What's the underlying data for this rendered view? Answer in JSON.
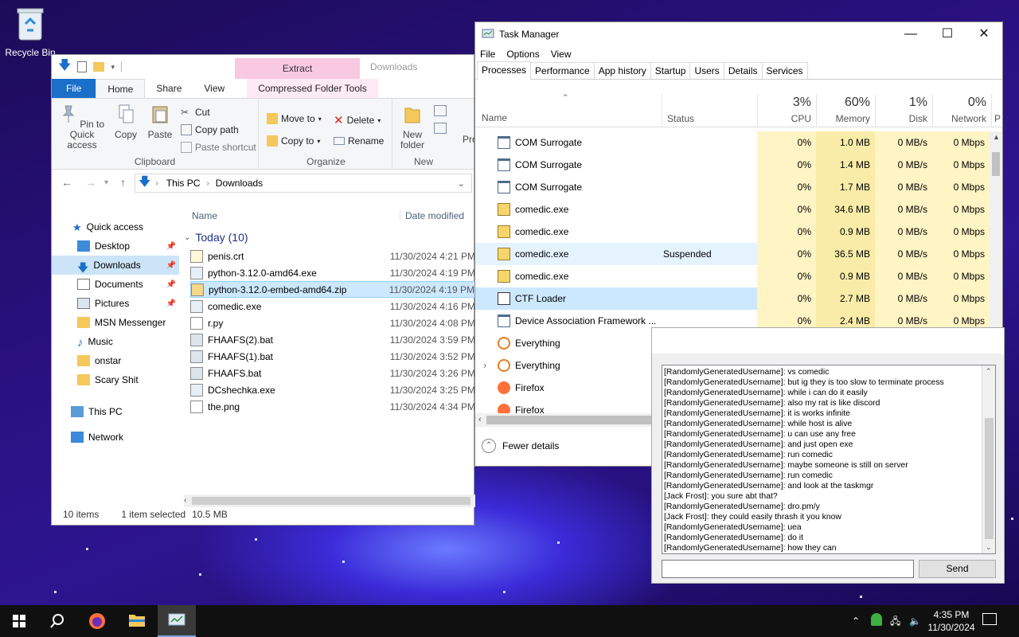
{
  "desktop": {
    "recycle_bin": "Recycle Bin"
  },
  "explorer": {
    "ribbon_tabs": {
      "file": "File",
      "home": "Home",
      "share": "Share",
      "view": "View",
      "extract": "Extract",
      "compressed": "Compressed Folder Tools",
      "downloads_title": "Downloads"
    },
    "clipboard": {
      "pin": "Pin to Quick access",
      "copy": "Copy",
      "paste": "Paste",
      "cut": "Cut",
      "copy_path": "Copy path",
      "paste_shortcut": "Paste shortcut",
      "group": "Clipboard"
    },
    "organize": {
      "move_to": "Move to",
      "copy_to": "Copy to",
      "delete": "Delete",
      "rename": "Rename",
      "group": "Organize"
    },
    "new": {
      "new_folder": "New folder",
      "group": "New",
      "properties": "Pro"
    },
    "address": {
      "this_pc": "This PC",
      "downloads": "Downloads"
    },
    "nav": {
      "quick_access": "Quick access",
      "items": [
        "Desktop",
        "Downloads",
        "Documents",
        "Pictures",
        "MSN Messenger",
        "Music",
        "onstar",
        "Scary Shit"
      ],
      "this_pc": "This PC",
      "network": "Network"
    },
    "columns": {
      "name": "Name",
      "date": "Date modified"
    },
    "group_header": "Today (10)",
    "files": [
      {
        "name": "penis.crt",
        "date": "11/30/2024 4:21 PM"
      },
      {
        "name": "python-3.12.0-amd64.exe",
        "date": "11/30/2024 4:19 PM"
      },
      {
        "name": "python-3.12.0-embed-amd64.zip",
        "date": "11/30/2024 4:19 PM"
      },
      {
        "name": "comedic.exe",
        "date": "11/30/2024 4:16 PM"
      },
      {
        "name": "r.py",
        "date": "11/30/2024 4:08 PM"
      },
      {
        "name": "FHAAFS(2).bat",
        "date": "11/30/2024 3:59 PM"
      },
      {
        "name": "FHAAFS(1).bat",
        "date": "11/30/2024 3:52 PM"
      },
      {
        "name": "FHAAFS.bat",
        "date": "11/30/2024 3:26 PM"
      },
      {
        "name": "DCshechka.exe",
        "date": "11/30/2024 3:25 PM"
      },
      {
        "name": "the.png",
        "date": "11/30/2024 4:34 PM"
      }
    ],
    "status": {
      "count": "10 items",
      "selected": "1 item selected",
      "size": "10.5 MB"
    }
  },
  "taskmgr": {
    "title": "Task Manager",
    "menu": {
      "file": "File",
      "options": "Options",
      "view": "View"
    },
    "tabs": [
      "Processes",
      "Performance",
      "App history",
      "Startup",
      "Users",
      "Details",
      "Services"
    ],
    "columns": {
      "name": "Name",
      "status": "Status",
      "cpu_pct": "3%",
      "cpu": "CPU",
      "mem_pct": "60%",
      "mem": "Memory",
      "disk_pct": "1%",
      "disk": "Disk",
      "net_pct": "0%",
      "net": "Network",
      "power": "P"
    },
    "processes": [
      {
        "name": "COM Surrogate",
        "status": "",
        "cpu": "0%",
        "mem": "1.0 MB",
        "disk": "0 MB/s",
        "net": "0 Mbps"
      },
      {
        "name": "COM Surrogate",
        "status": "",
        "cpu": "0%",
        "mem": "1.4 MB",
        "disk": "0 MB/s",
        "net": "0 Mbps"
      },
      {
        "name": "COM Surrogate",
        "status": "",
        "cpu": "0%",
        "mem": "1.7 MB",
        "disk": "0 MB/s",
        "net": "0 Mbps"
      },
      {
        "name": "comedic.exe",
        "status": "",
        "cpu": "0%",
        "mem": "34.6 MB",
        "disk": "0 MB/s",
        "net": "0 Mbps"
      },
      {
        "name": "comedic.exe",
        "status": "",
        "cpu": "0%",
        "mem": "0.9 MB",
        "disk": "0 MB/s",
        "net": "0 Mbps"
      },
      {
        "name": "comedic.exe",
        "status": "Suspended",
        "cpu": "0%",
        "mem": "36.5 MB",
        "disk": "0 MB/s",
        "net": "0 Mbps"
      },
      {
        "name": "comedic.exe",
        "status": "",
        "cpu": "0%",
        "mem": "0.9 MB",
        "disk": "0 MB/s",
        "net": "0 Mbps"
      },
      {
        "name": "CTF Loader",
        "status": "",
        "cpu": "0%",
        "mem": "2.7 MB",
        "disk": "0 MB/s",
        "net": "0 Mbps"
      },
      {
        "name": "Device Association Framework ...",
        "status": "",
        "cpu": "0%",
        "mem": "2.4 MB",
        "disk": "0 MB/s",
        "net": "0 Mbps"
      },
      {
        "name": "Everything",
        "status": "",
        "cpu": "",
        "mem": "",
        "disk": "",
        "net": ""
      },
      {
        "name": "Everything",
        "status": "",
        "cpu": "",
        "mem": "",
        "disk": "",
        "net": ""
      },
      {
        "name": "Firefox",
        "status": "",
        "cpu": "",
        "mem": "",
        "disk": "",
        "net": ""
      },
      {
        "name": "Firefox",
        "status": "",
        "cpu": "",
        "mem": "",
        "disk": "",
        "net": ""
      }
    ],
    "fewer_details": "Fewer details"
  },
  "chat": {
    "messages": [
      "[RandomlyGeneratedUsername]: vs comedic",
      "[RandomlyGeneratedUsername]: but ig they is too slow to terminate process",
      "[RandomlyGeneratedUsername]: while i can do it easily",
      "[RandomlyGeneratedUsername]: also my rat is like discord",
      "[RandomlyGeneratedUsername]: it is works infinite",
      "[RandomlyGeneratedUsername]: while host is alive",
      "[RandomlyGeneratedUsername]: u can use any free",
      "[RandomlyGeneratedUsername]: and just open exe",
      "[RandomlyGeneratedUsername]: run comedic",
      "[RandomlyGeneratedUsername]: maybe someone is still on server",
      "[RandomlyGeneratedUsername]: run comedic",
      "[RandomlyGeneratedUsername]: and look at the taskmgr",
      "[Jack Frost]: you sure abt that?",
      "[RandomlyGeneratedUsername]: dro.pm/y",
      "[Jack Frost]: they could easily thrash it you know",
      "[RandomlyGeneratedUsername]: uea",
      "[RandomlyGeneratedUsername]: do it",
      "[RandomlyGeneratedUsername]: how they can"
    ],
    "input_value": "",
    "send": "Send"
  },
  "taskbar": {
    "time": "4:35 PM",
    "date": "11/30/2024"
  }
}
